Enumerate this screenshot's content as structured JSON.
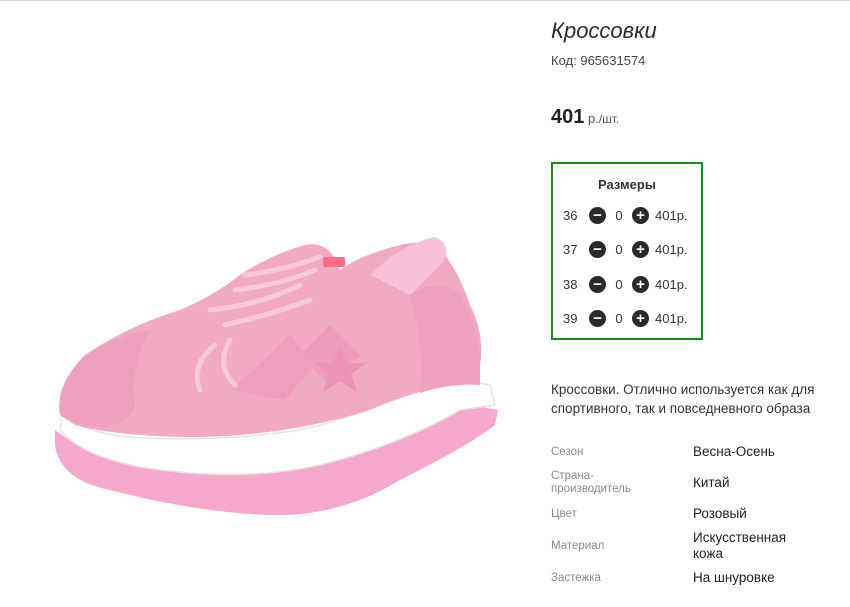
{
  "product": {
    "title": "Кроссовки",
    "code_label": "Код:",
    "code": "965631574",
    "price": "401",
    "price_unit_main": "р.",
    "price_unit_suffix": "/шт.",
    "image_alt": "pink sneaker"
  },
  "sizes": {
    "title": "Размеры",
    "rows": [
      {
        "size": "36",
        "qty": "0",
        "price": "401р."
      },
      {
        "size": "37",
        "qty": "0",
        "price": "401р."
      },
      {
        "size": "38",
        "qty": "0",
        "price": "401р."
      },
      {
        "size": "39",
        "qty": "0",
        "price": "401р."
      }
    ],
    "minus_symbol": "−",
    "plus_symbol": "+"
  },
  "description": "Кроссовки. Отлично используется как для спортивного, так и повседневного образа",
  "specs": [
    {
      "label": "Сезон",
      "value": "Весна-Осень"
    },
    {
      "label": "Страна-производитель",
      "value": "Китай"
    },
    {
      "label": "Цвет",
      "value": "Розовый"
    },
    {
      "label": "Материал",
      "value": "Искусственная кожа"
    },
    {
      "label": "Застежка",
      "value": "На шнуровке"
    }
  ],
  "colors": {
    "accent_border": "#1a8a1a",
    "shoe_pink": "#f2a9c4",
    "sole_white": "#ffffff"
  }
}
